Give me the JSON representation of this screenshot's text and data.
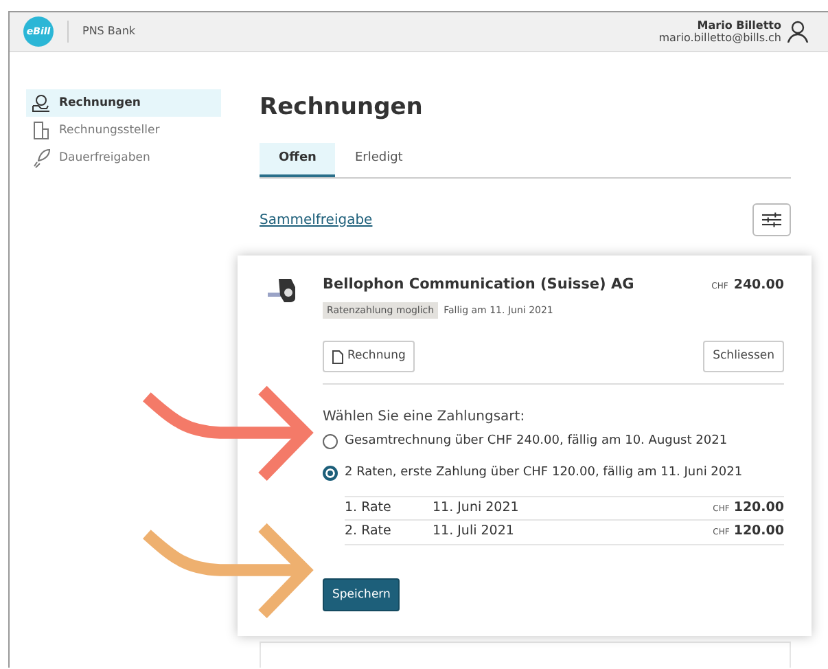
{
  "header": {
    "logo": "eBill",
    "bank": "PNS Bank",
    "user_name": "Mario Billetto",
    "user_email": "mario.billetto@bills.ch"
  },
  "sidebar": {
    "items": [
      {
        "label": "Rechnungen",
        "selected": true,
        "kind": "bills"
      },
      {
        "label": "Rechnungssteller",
        "selected": false,
        "kind": "billers"
      },
      {
        "label": "Dauerfreigaben",
        "selected": false,
        "kind": "standing"
      }
    ]
  },
  "title": "Rechnungen",
  "tabs": [
    {
      "label": "Offen",
      "selected": true
    },
    {
      "label": "Erledigt",
      "selected": false
    }
  ],
  "bulk_link": "Sammelfreigabe",
  "bill": {
    "company": "Bellophon Communication (Suisse) AG",
    "badge": "Ratenzahlung moglich",
    "due": "Fallig am 11. Juni 2021",
    "currency": "CHF",
    "amount": "240.00",
    "invoice_button": "Rechnung",
    "close_button": "Schliessen",
    "prompt": "Wählen Sie eine Zahlungsart:",
    "options": [
      {
        "label": "Gesamtrechnung über CHF 240.00, fällig am 10. August 2021",
        "selected": false
      },
      {
        "label": "2 Raten, erste Zahlung über CHF 120.00, fällig am 11. Juni 2021",
        "selected": true
      }
    ],
    "installments": [
      {
        "label": "1. Rate",
        "date": "11. Juni 2021",
        "currency": "CHF",
        "amount": "120.00"
      },
      {
        "label": "2. Rate",
        "date": "11. Juli 2021",
        "currency": "CHF",
        "amount": "120.00"
      }
    ],
    "save_button": "Speichern"
  }
}
